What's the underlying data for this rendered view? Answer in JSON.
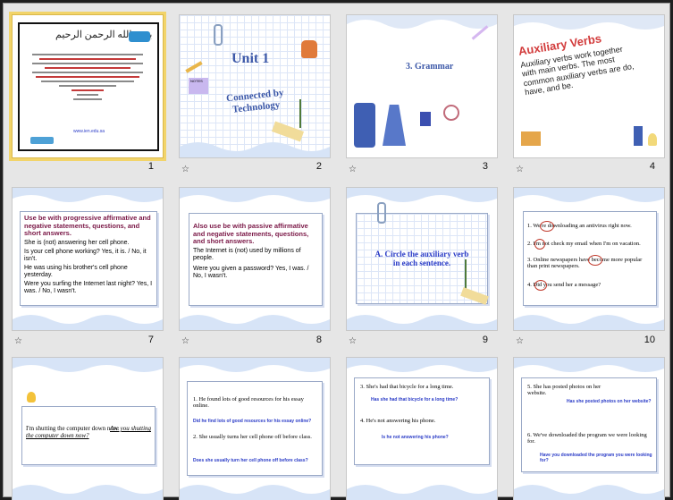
{
  "slides": [
    {
      "number": "1",
      "arabic_heading": "بسم الله الرحمن الرحيم",
      "arabic_body": [
        "تم تحميل هذا الملف من موقع المناهج السعودية",
        "هذا الملف متاح للتحميل مجانا",
        "زوروا موقعنا لمزيد من الملفات"
      ],
      "site": "www.ien.edu.sa"
    },
    {
      "number": "2",
      "unit": "Unit 1",
      "title": "Connected by Technology",
      "sticky": "NOTES"
    },
    {
      "number": "3",
      "heading": "3. Grammar"
    },
    {
      "number": "4",
      "title": "Auxiliary Verbs",
      "body": "Auxiliary verbs work together with main verbs. The most common auxiliary verbs are do, have, and be."
    },
    {
      "number": "7",
      "heading": "Use be with progressive affirmative and negative statements, questions, and short answers.",
      "lines": [
        "She is (not) answering her cell phone.",
        "Is your cell phone working? Yes, it is. / No, it isn't.",
        "He was using his brother's cell phone yesterday.",
        "Were you surfing the Internet last night? Yes, I was. / No, I wasn't."
      ]
    },
    {
      "number": "8",
      "heading": "Also use be with passive affirmative and negative statements, questions, and short answers.",
      "lines": [
        "The Internet is (not) used by millions of people.",
        "Were you given a password? Yes, I was. / No, I wasn't."
      ]
    },
    {
      "number": "9",
      "instruction": "A. Circle the auxiliary verb in each sentence."
    },
    {
      "number": "10",
      "items": [
        "1. We're downloading an antivirus right now.",
        "2. I'm not check my email when I'm on vacation.",
        "3. Online newspapers have become more popular than print newspapers.",
        "4. Did you send her a message?"
      ]
    },
    {
      "number": "",
      "sentence": "I'm shutting the computer down now.",
      "answer": "Are you shutting the computer down now?"
    },
    {
      "number": "",
      "q1": "1. He found lots of good resources for his essay online.",
      "a1": "Did he find lots of good resources for his essay online?",
      "q2": "2. She usually turns her cell phone off before class.",
      "a2": "Does she usually turn her cell phone off before class?"
    },
    {
      "number": "",
      "q1": "3. She's had that bicycle for a long time.",
      "a1": "Has she had that bicycle for a long time?",
      "q2": "4. He's not answering his phone.",
      "a2": "Is he not answering his phone?"
    },
    {
      "number": "",
      "q1": "5. She has posted photos on her website.",
      "a1": "Has she posted photos on her website?",
      "q2": "6. We've downloaded the program we were looking for.",
      "a2": "Have you downloaded the program you were looking for?"
    }
  ]
}
